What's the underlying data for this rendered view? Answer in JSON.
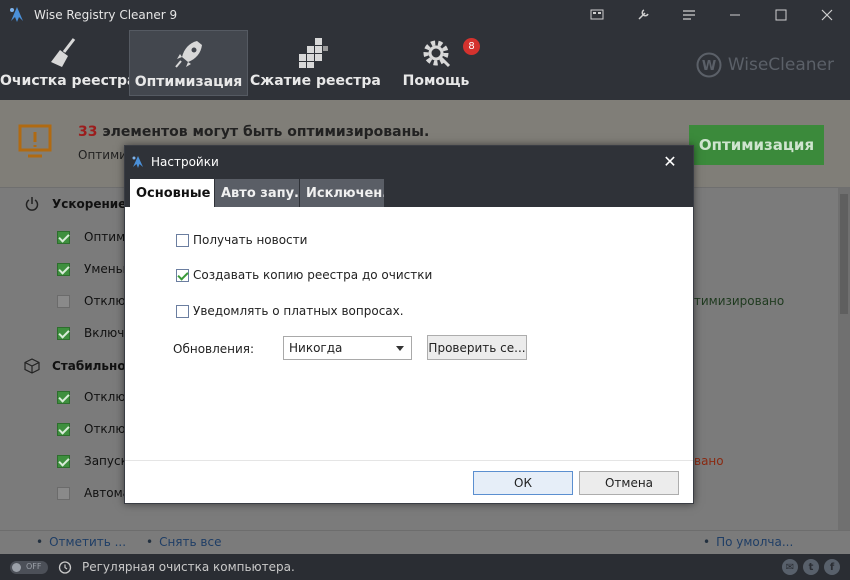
{
  "window": {
    "title": "Wise Registry Cleaner 9"
  },
  "toolbar": {
    "items": [
      {
        "label": "Очистка реестра",
        "icon": "broom-icon"
      },
      {
        "label": "Оптимизация",
        "icon": "rocket-icon"
      },
      {
        "label": "Сжатие реестра",
        "icon": "blocks-icon"
      },
      {
        "label": "Помощь",
        "icon": "gear-wrench-icon"
      }
    ],
    "help_badge": "8",
    "brand": {
      "logo_letter": "W",
      "text": "WiseCleaner"
    }
  },
  "banner": {
    "count": "33",
    "headline_rest": " элементов могут быть оптимизированы.",
    "subline": "Оптими",
    "action_label": "Оптимизация"
  },
  "sections": [
    {
      "label": "Ускорение з",
      "icon": "power-icon"
    },
    {
      "label": "Стабильност",
      "icon": "box-icon"
    }
  ],
  "rows": [
    {
      "label": "Оптими",
      "checked": true
    },
    {
      "label": "Уменьш",
      "checked": true
    },
    {
      "label": "Отключ",
      "checked": false
    },
    {
      "label": "Включи",
      "checked": true
    },
    {
      "label": "Отключ",
      "checked": true
    },
    {
      "label": "Отключ",
      "checked": true
    },
    {
      "label": "Запуска",
      "checked": true
    },
    {
      "label": "Автомат",
      "checked": false
    }
  ],
  "row_status": {
    "optimized_text": "птимизировано",
    "tail_text": "вано"
  },
  "linkbar": {
    "check_label": "Отметить ...",
    "uncheck_label": "Снять все",
    "default_label": "По умолча..."
  },
  "statusbar": {
    "toggle_label": "OFF",
    "text": "Регулярная очистка компьютера."
  },
  "dialog": {
    "title": "Настройки",
    "tabs": [
      {
        "label": "Основные"
      },
      {
        "label": "Авто запу..."
      },
      {
        "label": "Исключен..."
      }
    ],
    "options": [
      {
        "label": "Получать новости",
        "checked": false
      },
      {
        "label": "Создавать копию реестра до очистки",
        "checked": true
      },
      {
        "label": "Уведомлять о платных вопросах.",
        "checked": false
      }
    ],
    "updates_label": "Обновления:",
    "updates_value": "Никогда",
    "check_button": "Проверить се...",
    "ok": "ОК",
    "cancel": "Отмена"
  },
  "colors": {
    "accent_green": "#3b8a3b",
    "count_red": "#9c1d1d",
    "titlebar": "#2f3238",
    "badge_red": "#d4322e"
  }
}
